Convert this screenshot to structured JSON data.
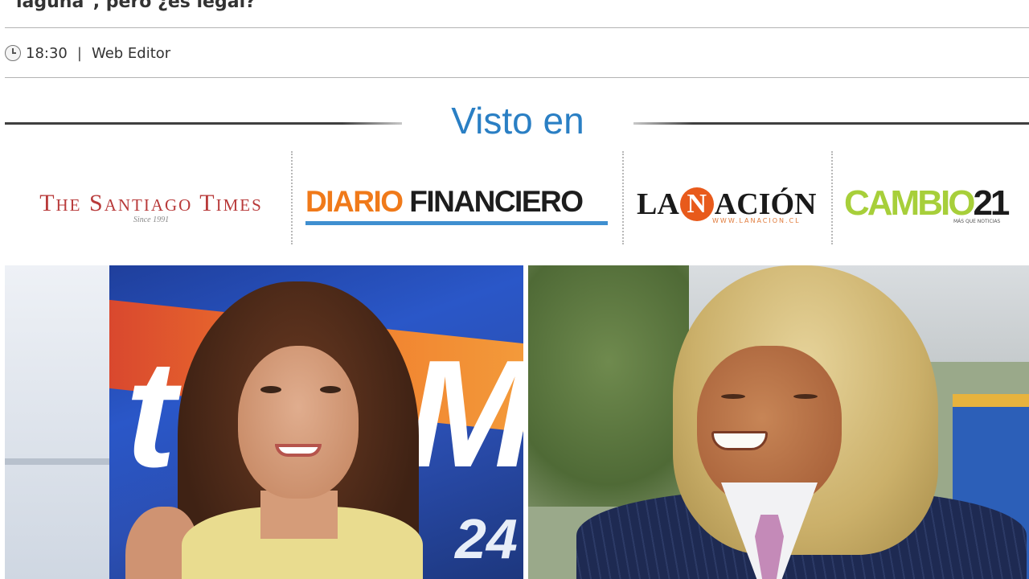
{
  "article": {
    "headline_fragment": "laguna\", pero ¿es legal?",
    "time": "18:30",
    "separator": "|",
    "author": "Web Editor"
  },
  "visto_en": {
    "title": "Visto en",
    "logos": {
      "santiago_times": {
        "name": "The Santiago Times",
        "tagline": "Since 1991"
      },
      "diario_financiero": {
        "part1": "DIARIO",
        "part2": "FINANCIERO"
      },
      "la_nacion": {
        "part1": "LA",
        "n": "N",
        "part2": "ACIÓN",
        "url": "WWW.LANACION.CL"
      },
      "cambio21": {
        "part1": "CAMBIO",
        "part2": "21",
        "tagline": "MÁS QUE NOTICIAS"
      }
    },
    "colors": {
      "title": "#2a7fc4",
      "df_orange": "#f07a1a",
      "df_bar": "#3f8fd0",
      "ln_orange": "#e85a1b",
      "c21_green": "#a7cf3a",
      "st_red": "#b83a3a"
    }
  },
  "photo": {
    "left_screen_text": "t",
    "left_screen_text2": "M",
    "left_screen_number": "24"
  }
}
